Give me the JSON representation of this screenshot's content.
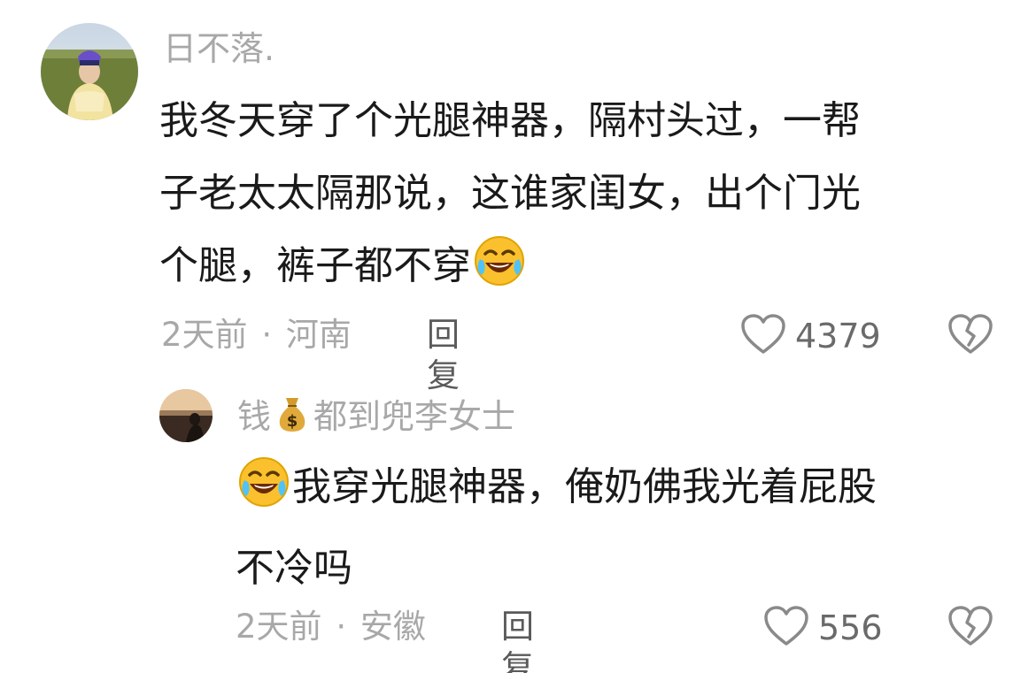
{
  "comments": [
    {
      "username": "日不落.",
      "content_lines": [
        "我冬天穿了个光腿神器，隔村头过，一帮",
        "子老太太隔那说，这谁家闺女，出个门光",
        "个腿，裤子都不穿"
      ],
      "content_emoji": "rofl-emoji",
      "time": "2天前",
      "separator": "·",
      "location": "河南",
      "reply_label": "回复",
      "like_count": "4379"
    }
  ],
  "replies": [
    {
      "username_prefix": "钱",
      "username_emoji": "money-bag-emoji",
      "username_suffix": "都到兜李女士",
      "content_emoji": "rofl-emoji",
      "content_lines": [
        "我穿光腿神器，俺奶佛我光着屁股",
        "不冷吗"
      ],
      "time": "2天前",
      "separator": "·",
      "location": "安徽",
      "reply_label": "回复",
      "like_count": "556"
    }
  ]
}
